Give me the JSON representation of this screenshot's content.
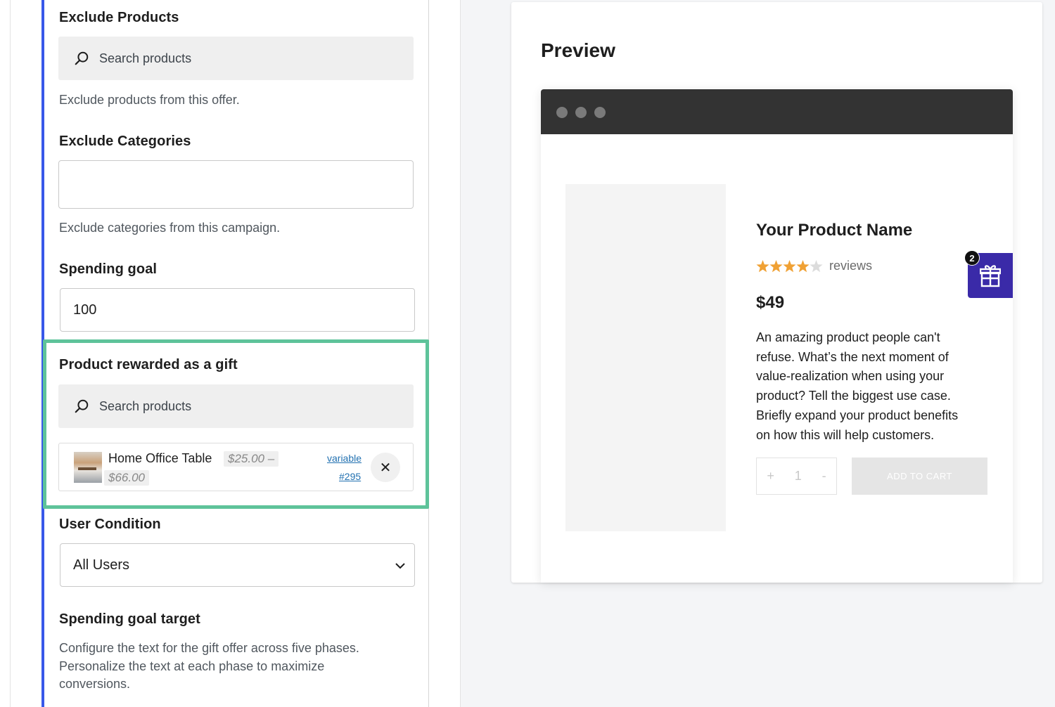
{
  "settings": {
    "exclude_products": {
      "label": "Exclude Products",
      "placeholder": "Search products",
      "help": "Exclude products from this offer."
    },
    "exclude_categories": {
      "label": "Exclude Categories",
      "value": "",
      "help": "Exclude categories from this campaign."
    },
    "spending_goal": {
      "label": "Spending goal",
      "value": "100"
    },
    "gift_product": {
      "label": "Product rewarded as a gift",
      "placeholder": "Search products",
      "selected": {
        "name": "Home Office Table",
        "price_from": "$25.00 –",
        "price_to": "$66.00",
        "type_link": "variable",
        "id_link": "#295"
      }
    },
    "user_condition": {
      "label": "User Condition",
      "selected": "All Users"
    },
    "spending_goal_target": {
      "label": "Spending goal target",
      "help_lines": [
        "Configure the text for the gift offer across five phases.",
        "Personalize the text at each phase to maximize",
        "conversions."
      ]
    }
  },
  "preview": {
    "title": "Preview",
    "product": {
      "name": "Your Product Name",
      "rating": 4,
      "rating_max": 5,
      "reviews_label": "reviews",
      "price": "$49",
      "description_lines": [
        "An amazing product people can't",
        "refuse. What’s the next moment of",
        "value-realization when using your",
        "product? Tell the biggest use case.",
        "Briefly expand your product benefits",
        "on how this will help customers."
      ],
      "qty_plus": "+",
      "qty_value": "1",
      "qty_minus": "-",
      "add_to_cart": "ADD TO CART"
    },
    "gift_widget": {
      "badge_count": "2",
      "icon": "gift-icon"
    }
  },
  "colors": {
    "accent_blue": "#3858e9",
    "highlight_green": "#5ec39a",
    "gift_widget_purple": "#3a2aa8",
    "star_orange": "#f0a134",
    "browser_bar": "#333333"
  }
}
